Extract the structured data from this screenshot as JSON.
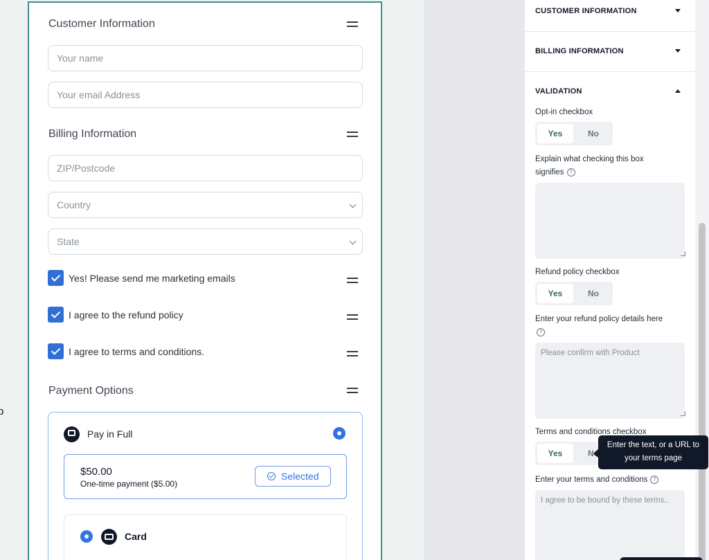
{
  "left": {
    "stray_char": "p"
  },
  "form": {
    "customer": {
      "title": "Customer Information",
      "name_placeholder": "Your name",
      "email_placeholder": "Your email Address"
    },
    "billing": {
      "title": "Billing Information",
      "zip_placeholder": "ZIP/Postcode",
      "country_placeholder": "Country",
      "state_placeholder": "State"
    },
    "checkboxes": [
      {
        "label": "Yes! Please send me marketing emails",
        "checked": true
      },
      {
        "label": "I agree to the refund policy",
        "checked": true
      },
      {
        "label": "I agree to terms and conditions.",
        "checked": true
      }
    ],
    "payment": {
      "title": "Payment Options",
      "pay_in_full_label": "Pay in Full",
      "price": "$50.00",
      "price_sub": "One-time payment ($5.00)",
      "selected_label": "Selected",
      "card_label": "Card"
    }
  },
  "panel": {
    "sections": {
      "customer": "CUSTOMER INFORMATION",
      "billing": "BILLING INFORMATION",
      "validation": "VALIDATION"
    },
    "optin": {
      "label": "Opt-in checkbox",
      "yes": "Yes",
      "no": "No",
      "explain_label": "Explain what checking this box signifies",
      "explain_value": ""
    },
    "refund": {
      "label": "Refund policy checkbox",
      "yes": "Yes",
      "no": "No",
      "details_label": "Enter your refund policy details here",
      "details_placeholder": "Please confirm with Product"
    },
    "terms": {
      "label": "Terms and conditions checkbox",
      "yes": "Yes",
      "no": "No",
      "enter_label": "Enter your terms and conditions",
      "enter_placeholder": "I agree to be bound by these terms.."
    },
    "help_glyph": "?"
  },
  "tooltip": {
    "line1": "Enter the text, or a URL to",
    "line2": "your terms page"
  },
  "colors": {
    "accent": "#2f6fd6",
    "brand_green": "#3f8f8a",
    "dark": "#111827"
  }
}
